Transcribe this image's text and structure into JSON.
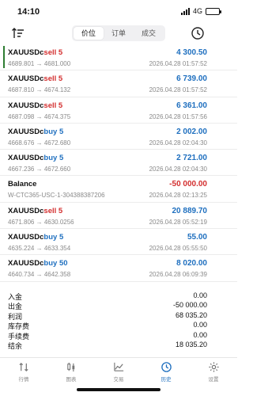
{
  "status": {
    "time": "14:10",
    "network": "4G"
  },
  "segments": [
    {
      "label": "价位",
      "active": true
    },
    {
      "label": "订单",
      "active": false
    },
    {
      "label": "成交",
      "active": false
    }
  ],
  "rows": [
    {
      "symbol": "XAUUSDc",
      "side": "sell",
      "lots": "5",
      "prices": "4689.801 → 4681.000",
      "profit": "4 300.50",
      "profit_sign": "pos",
      "time": "2026.04.28 01:57:52"
    },
    {
      "symbol": "XAUUSDc",
      "side": "sell",
      "lots": "5",
      "prices": "4687.810 → 4674.132",
      "profit": "6 739.00",
      "profit_sign": "pos",
      "time": "2026.04.28 01:57:52"
    },
    {
      "symbol": "XAUUSDc",
      "side": "sell",
      "lots": "5",
      "prices": "4687.098 → 4674.375",
      "profit": "6 361.00",
      "profit_sign": "pos",
      "time": "2026.04.28 01:57:56"
    },
    {
      "symbol": "XAUUSDc",
      "side": "buy",
      "lots": "5",
      "prices": "4668.676 → 4672.680",
      "profit": "2 002.00",
      "profit_sign": "pos",
      "time": "2026.04.28 02:04:30"
    },
    {
      "symbol": "XAUUSDc",
      "side": "buy",
      "lots": "5",
      "prices": "4667.236 → 4672.660",
      "profit": "2 721.00",
      "profit_sign": "pos",
      "time": "2026.04.28 02:04:30"
    },
    {
      "symbol": "Balance",
      "side": "",
      "lots": "",
      "prices": "W-CTC365-USC-1-304388387206",
      "profit": "-50 000.00",
      "profit_sign": "neg",
      "time": "2026.04.28 02:13:25"
    },
    {
      "symbol": "XAUUSDc",
      "side": "sell",
      "lots": "5",
      "prices": "4671.806 → 4630.0256",
      "profit": "20 889.70",
      "profit_sign": "pos",
      "time": "2026.04.28 05:52:19"
    },
    {
      "symbol": "XAUUSDc",
      "side": "buy",
      "lots": "5",
      "prices": "4635.224 → 4633.354",
      "profit": "55.00",
      "profit_sign": "pos",
      "time": "2026.04.28 05:55:50"
    },
    {
      "symbol": "XAUUSDc",
      "side": "buy",
      "lots": "50",
      "prices": "4640.734 → 4642.358",
      "profit": "8 020.00",
      "profit_sign": "pos",
      "time": "2026.04.28 06:09:39"
    }
  ],
  "summary": [
    {
      "label": "入金",
      "value": "0.00"
    },
    {
      "label": "出金",
      "value": "-50 000.00"
    },
    {
      "label": "利润",
      "value": "68 035.20"
    },
    {
      "label": "库存费",
      "value": "0.00"
    },
    {
      "label": "手续费",
      "value": "0.00"
    },
    {
      "label": "结余",
      "value": "18 035.20"
    }
  ],
  "tabs": [
    {
      "label": "行情",
      "icon": "quotes-icon",
      "active": false
    },
    {
      "label": "图表",
      "icon": "chart-icon",
      "active": false
    },
    {
      "label": "交易",
      "icon": "trade-icon",
      "active": false
    },
    {
      "label": "历史",
      "icon": "history-icon",
      "active": true
    },
    {
      "label": "设置",
      "icon": "settings-icon",
      "active": false
    }
  ],
  "colors": {
    "buy": "#1e6fbf",
    "sell": "#d32f2f",
    "accent": "#1e6fbf",
    "first_row_marker": "#2e7d32"
  }
}
